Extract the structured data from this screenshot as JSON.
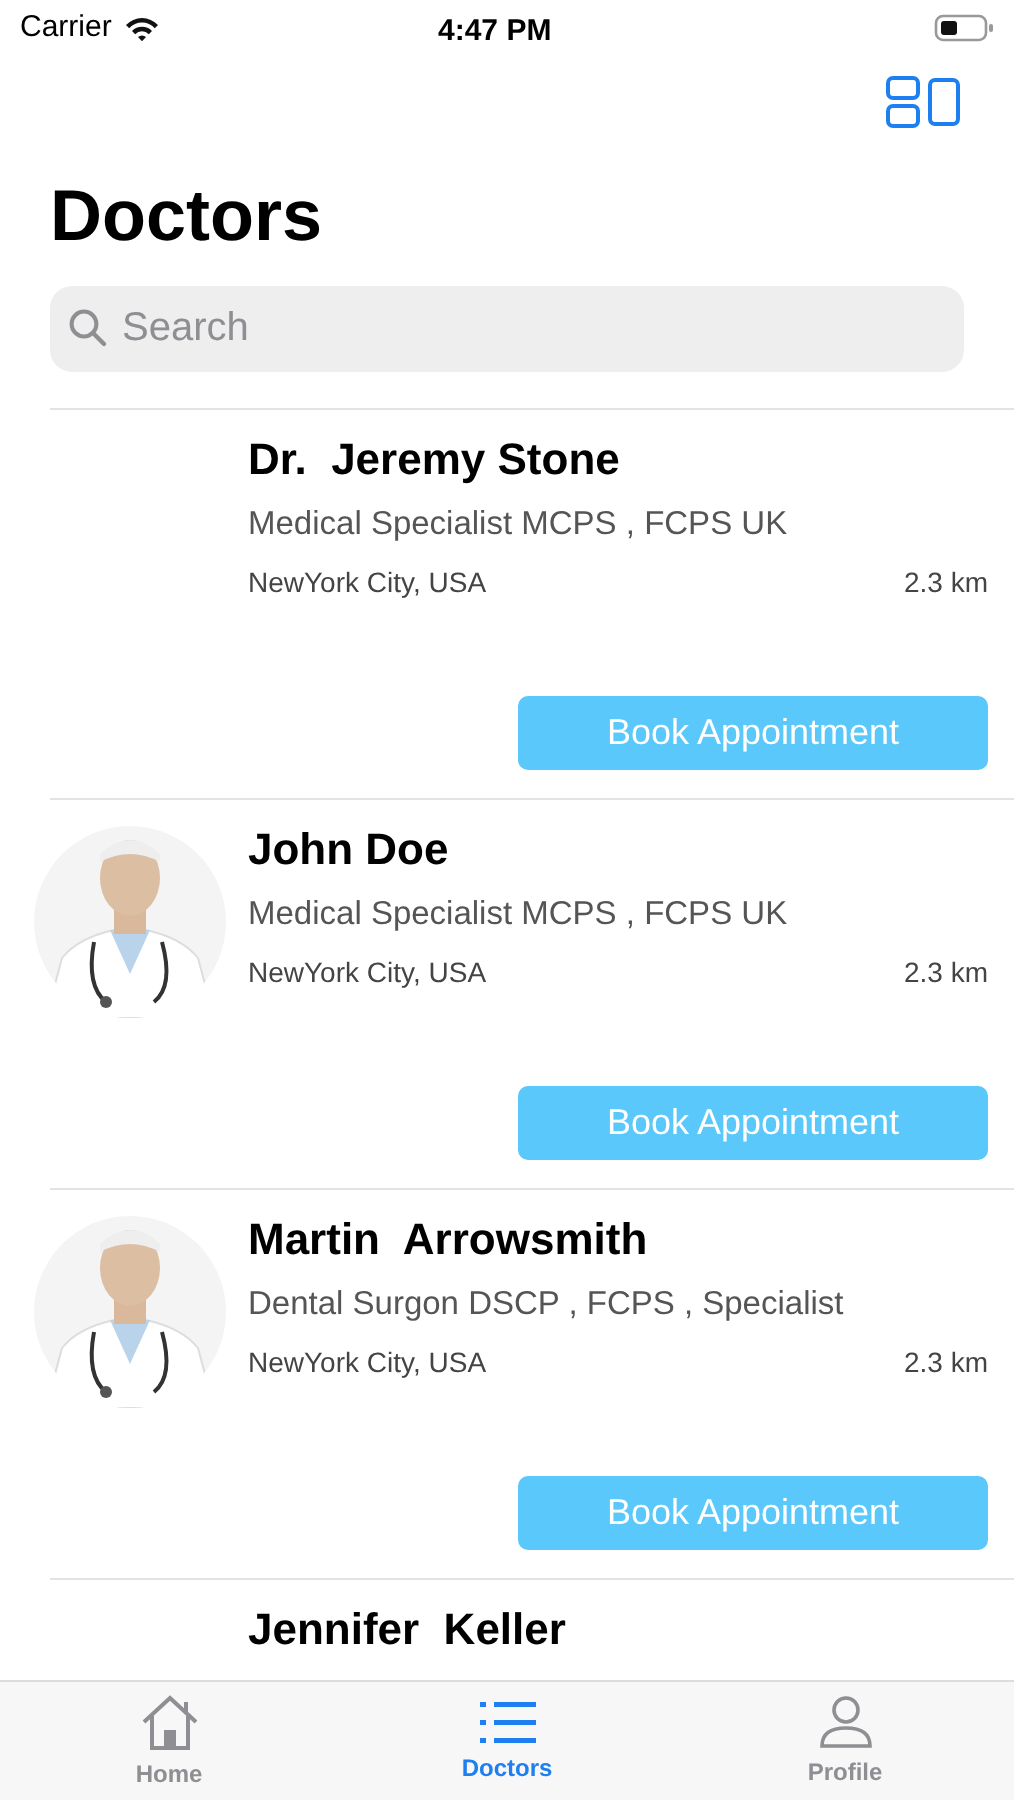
{
  "status_bar": {
    "carrier": "Carrier",
    "time": "4:47 PM"
  },
  "title": "Doctors",
  "search": {
    "placeholder": "Search"
  },
  "doctors": [
    {
      "name": "Dr.  Jeremy Stone",
      "specialty": "Medical Specialist MCPS , FCPS UK",
      "location": "NewYork City, USA",
      "distance": "2.3 km",
      "button": "Book Appointment"
    },
    {
      "name": "John Doe",
      "specialty": "Medical Specialist MCPS , FCPS UK",
      "location": "NewYork City, USA",
      "distance": "2.3 km",
      "button": "Book Appointment"
    },
    {
      "name": "Martin  Arrowsmith",
      "specialty": "Dental Surgon DSCP , FCPS , Specialist",
      "location": "NewYork City, USA",
      "distance": "2.3 km",
      "button": "Book Appointment"
    },
    {
      "name": "Jennifer  Keller"
    }
  ],
  "tab_bar": [
    {
      "label": "Home",
      "selected": false
    },
    {
      "label": "Doctors",
      "selected": true
    },
    {
      "label": "Profile",
      "selected": false
    }
  ]
}
